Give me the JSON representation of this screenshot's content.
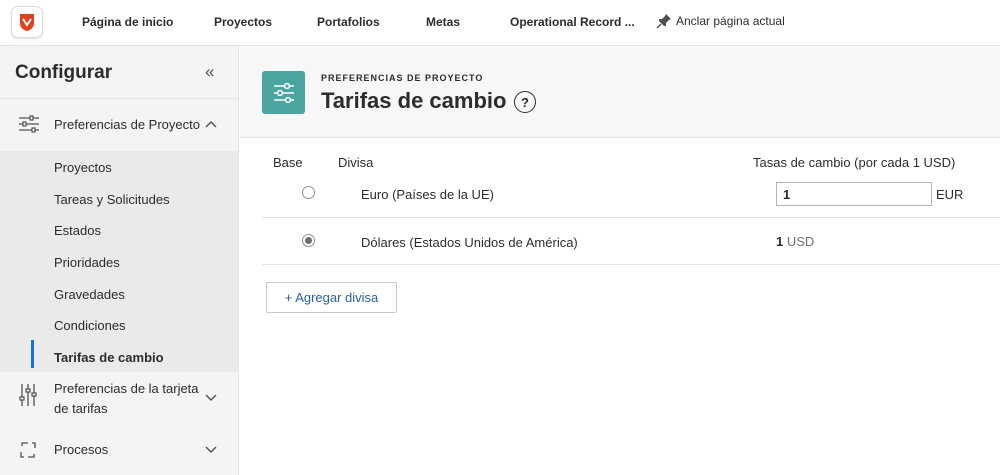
{
  "topnav": {
    "items": [
      {
        "label": "Página de inicio",
        "name": "nav-home"
      },
      {
        "label": "Proyectos",
        "name": "nav-projects"
      },
      {
        "label": "Portafolios",
        "name": "nav-portfolios"
      },
      {
        "label": "Metas",
        "name": "nav-goals"
      },
      {
        "label": "Operational Record ...",
        "name": "nav-operational-record"
      }
    ],
    "pin_label": "Anclar página actual"
  },
  "sidebar": {
    "title": "Configurar",
    "sections": [
      {
        "label": "Preferencias de Proyecto",
        "icon": "sliders-icon",
        "expanded": true
      },
      {
        "label": "Preferencias de la tarjeta de tarifas",
        "icon": "vertical-sliders-icon",
        "expanded": false
      },
      {
        "label": "Procesos",
        "icon": "cycle-icon",
        "expanded": false
      }
    ],
    "subitems": [
      {
        "label": "Proyectos"
      },
      {
        "label": "Tareas y Solicitudes"
      },
      {
        "label": "Estados"
      },
      {
        "label": "Prioridades"
      },
      {
        "label": "Gravedades"
      },
      {
        "label": "Condiciones"
      },
      {
        "label": "Tarifas de cambio",
        "active": true
      }
    ]
  },
  "header": {
    "eyebrow": "PREFERENCIAS DE PROYECTO",
    "title": "Tarifas de cambio",
    "help": "?",
    "icon": "settings-sliders-icon"
  },
  "table": {
    "headers": {
      "base": "Base",
      "currency": "Divisa",
      "rates": "Tasas de cambio (por cada 1 USD)"
    },
    "rows": [
      {
        "base_selected": false,
        "currency": "Euro (Países de la UE)",
        "rate_value": "1",
        "unit": "EUR",
        "editable": true
      },
      {
        "base_selected": true,
        "currency": "Dólares (Estados Unidos de América)",
        "rate_value": "1",
        "unit": "USD",
        "editable": false
      }
    ]
  },
  "add_button": "+ Agregar divisa",
  "colors": {
    "accent": "#1473e6",
    "header_icon_bg": "#4aa5a0",
    "link": "#2c5f9e",
    "logo": "#e0401c"
  }
}
